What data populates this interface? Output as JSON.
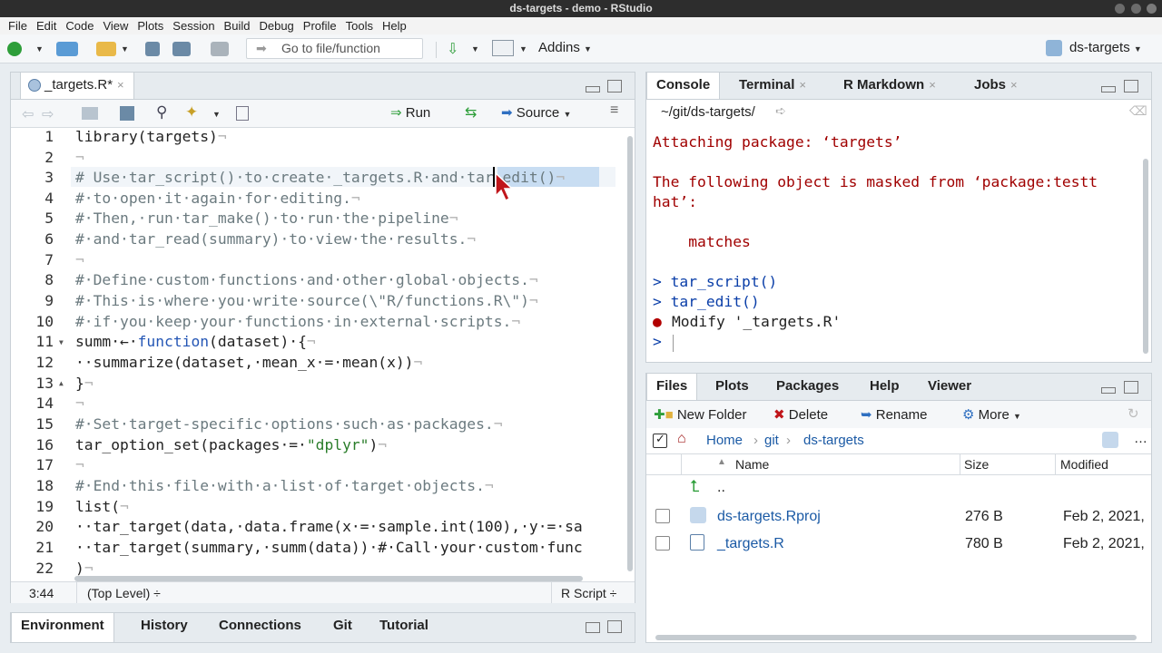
{
  "window": {
    "title": "ds-targets - demo - RStudio"
  },
  "menu": [
    "File",
    "Edit",
    "Code",
    "View",
    "Plots",
    "Session",
    "Build",
    "Debug",
    "Profile",
    "Tools",
    "Help"
  ],
  "toolbar": {
    "goto_placeholder": "Go to file/function",
    "addins_label": "Addins",
    "project_label": "ds-targets"
  },
  "editor": {
    "tab_label": "_targets.R*",
    "run_label": "Run",
    "source_label": "Source",
    "line_numbers": [
      "1",
      "2",
      "3",
      "4",
      "5",
      "6",
      "7",
      "8",
      "9",
      "10",
      "11",
      "12",
      "13",
      "14",
      "15",
      "16",
      "17",
      "18",
      "19",
      "20",
      "21",
      "22"
    ],
    "status": {
      "position": "3:44",
      "scope": "(Top Level) ÷",
      "filetype": "R Script ÷"
    }
  },
  "console": {
    "tabs": [
      "Console",
      "Terminal",
      "R Markdown",
      "Jobs"
    ],
    "path": "~/git/ds-targets/",
    "lines": [
      "Attaching package: ‘targets’",
      "The following object is masked from ‘package:testt",
      "hat’:",
      "    matches",
      "> tar_script()",
      "> tar_edit()",
      "Modify '_targets.R'",
      ">"
    ]
  },
  "files": {
    "tabs": [
      "Files",
      "Plots",
      "Packages",
      "Help",
      "Viewer"
    ],
    "actions": {
      "new_folder": "New Folder",
      "delete": "Delete",
      "rename": "Rename",
      "more": "More"
    },
    "breadcrumb": [
      "Home",
      "git",
      "ds-targets"
    ],
    "columns": {
      "name": "Name",
      "size": "Size",
      "modified": "Modified"
    },
    "up_label": "..",
    "rows": [
      {
        "name": "ds-targets.Rproj",
        "size": "276 B",
        "modified": "Feb 2, 2021,"
      },
      {
        "name": "_targets.R",
        "size": "780 B",
        "modified": "Feb 2, 2021,"
      }
    ]
  },
  "bottom_tabs": [
    "Environment",
    "History",
    "Connections",
    "Git",
    "Tutorial"
  ]
}
